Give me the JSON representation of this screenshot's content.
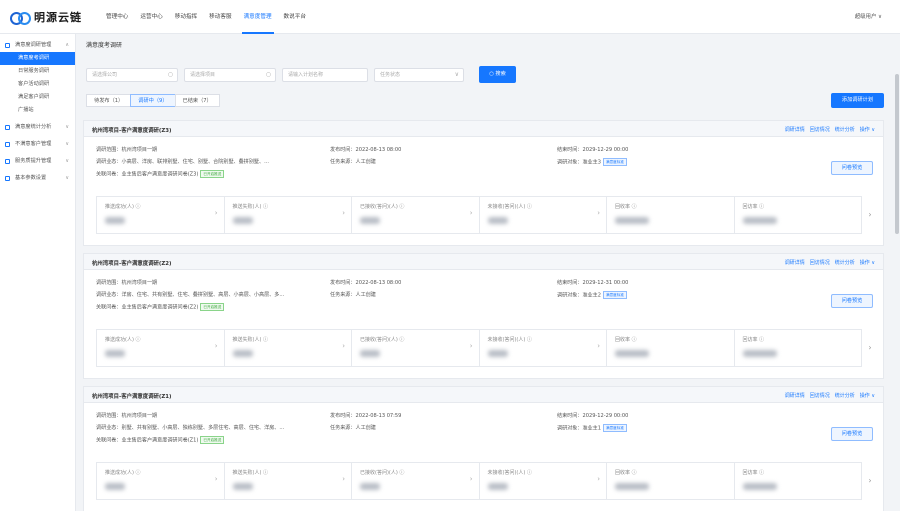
{
  "app": {
    "logo_text": "明源云链"
  },
  "nav": [
    {
      "label": "管理中心",
      "active": false
    },
    {
      "label": "运营中心",
      "active": false
    },
    {
      "label": "移动指挥",
      "active": false
    },
    {
      "label": "移动客服",
      "active": false
    },
    {
      "label": "满意度管理",
      "active": true
    },
    {
      "label": "数说平台",
      "active": false
    }
  ],
  "user": {
    "label": "超级用户 ∨"
  },
  "sidebar": {
    "groups": [
      {
        "label": "满意度调研管理",
        "chevron": "∧",
        "items": [
          {
            "label": "满意度考调研",
            "active": true
          },
          {
            "label": "日常服务调研",
            "active": false
          },
          {
            "label": "客户活动调研",
            "active": false
          },
          {
            "label": "满足客户调研",
            "active": false
          },
          {
            "label": "广播站",
            "active": false
          }
        ]
      },
      {
        "label": "满意度统计分析",
        "chevron": "∨",
        "items": []
      },
      {
        "label": "不满意客户管理",
        "chevron": "∨",
        "items": []
      },
      {
        "label": "服务质提升管理",
        "chevron": "∨",
        "items": []
      },
      {
        "label": "基本参数设置",
        "chevron": "∨",
        "items": []
      }
    ]
  },
  "page": {
    "title": "满意度考调研",
    "filters": {
      "company": "请选择公司",
      "project": "请选择项目",
      "plan": "请输入计划名称",
      "status": "任务状态",
      "search_label": "搜索"
    },
    "tabs": [
      {
        "label": "待发布（1）",
        "active": false
      },
      {
        "label": "调研中（9）",
        "active": true
      },
      {
        "label": "已结束（7）",
        "active": false
      }
    ],
    "add_label": "添加调研计划"
  },
  "card_actions": [
    "调研详情",
    "回访情况",
    "统计分析",
    "操作 ∨"
  ],
  "stat_labels": [
    "推送成功(人) ⓘ",
    "推送失败(人) ⓘ",
    "已接收(答问)(人) ⓘ",
    "未接收(答问)(人) ⓘ",
    "回收率 ⓘ",
    "回访率 ⓘ"
  ],
  "preview_label": "问卷预览",
  "cards": [
    {
      "title": "杭州湾项目-客户满意度调研(Z3)",
      "scope": "调研范围：杭州湾项目一期",
      "publish_time": "发布时间：2022-08-13 08:00",
      "end_time": "结束时间：2029-12-29 00:00",
      "objects": "调研业态：小高层、洋房、联排别墅、住宅、别墅、合院别墅、叠拼别墅、...",
      "source": "任务来源：人工创建",
      "target": "调研对象：准业主3",
      "target_tag": "满意度标准",
      "questionnaire": "关联问卷：业主售后客户满意度调研问卷(Z3)",
      "q_tag": "已开启推送"
    },
    {
      "title": "杭州湾项目-客户满意度调研(Z2)",
      "scope": "调研范围：杭州湾项目一期",
      "publish_time": "发布时间：2022-08-13 08:00",
      "end_time": "结束时间：2029-12-31 00:00",
      "objects": "调研业态：洋房、住宅、共有别墅、住宅、叠拼别墅、高层、小高层、小高层、多...",
      "source": "任务来源：人工创建",
      "target": "调研对象：准业主2",
      "target_tag": "满意度标准",
      "questionnaire": "关联问卷：业主售后客户满意度调研问卷(Z2)",
      "q_tag": "已开启推送"
    },
    {
      "title": "杭州湾项目-客户满意度调研(Z1)",
      "scope": "调研范围：杭州湾项目一期",
      "publish_time": "发布时间：2022-08-13 07:59",
      "end_time": "结束时间：2029-12-29 00:00",
      "objects": "调研业态：别墅、共有别墅、小高层、独栋别墅、多层住宅、高层、住宅、洋房、...",
      "source": "任务来源：人工创建",
      "target": "调研对象：准业主1",
      "target_tag": "满意度标准",
      "questionnaire": "关联问卷：业主售后客户满意度调研问卷(Z1)",
      "q_tag": "已开启推送"
    }
  ]
}
